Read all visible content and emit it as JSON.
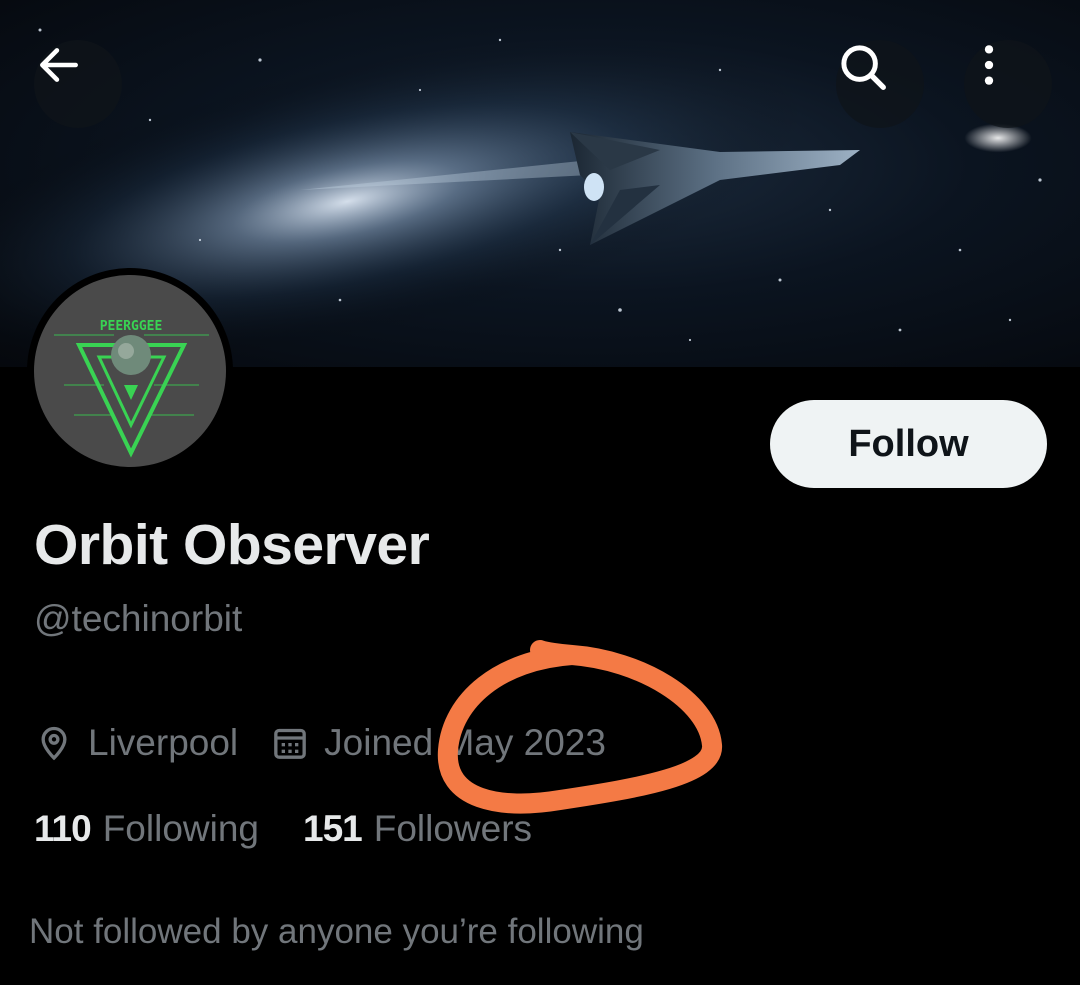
{
  "header": {
    "back_icon": "arrow-left-icon",
    "search_icon": "search-icon",
    "more_icon": "more-vertical-icon"
  },
  "profile": {
    "avatar_text": "PEERGGEE",
    "display_name": "Orbit Observer",
    "handle": "@techinorbit",
    "follow_label": "Follow",
    "location": "Liverpool",
    "joined": "Joined May 2023",
    "following_count": "110",
    "following_label": "Following",
    "followers_count": "151",
    "followers_label": "Followers",
    "not_followed_text": "Not followed by anyone you’re following"
  },
  "colors": {
    "background": "#000000",
    "primary_text": "#e7e9ea",
    "secondary_text": "#71767b",
    "follow_button_bg": "#eff3f4",
    "annotation": "#f47a45",
    "avatar_accent": "#39d353"
  }
}
